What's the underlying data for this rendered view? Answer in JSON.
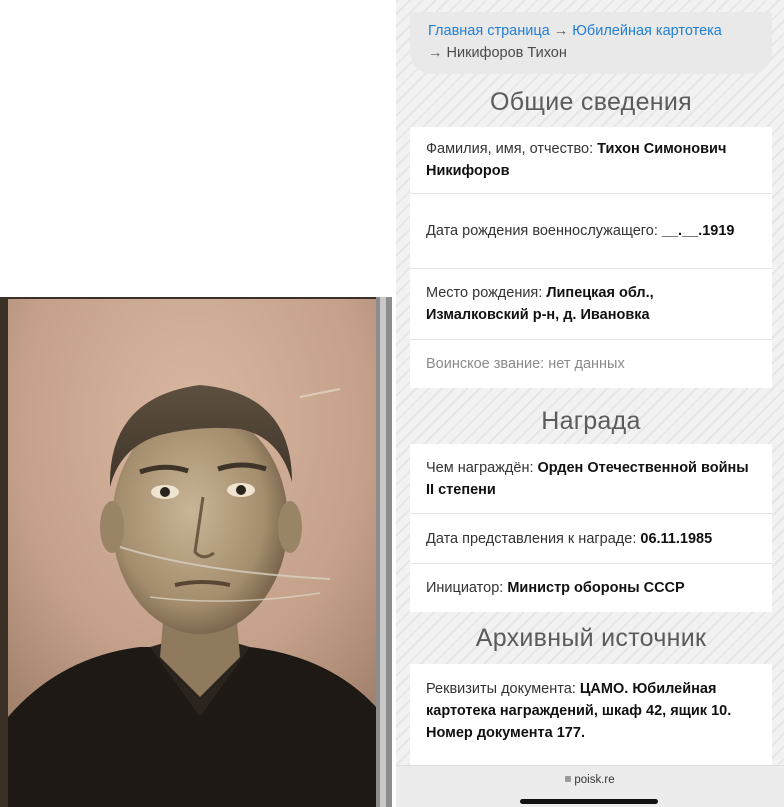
{
  "breadcrumb": {
    "home": "Главная страница",
    "arrow": "→",
    "catalog": "Юбилейная картотека",
    "current": "Никифоров Тихон"
  },
  "sections": {
    "general": {
      "title": "Общие сведения",
      "fio_label": "Фамилия, имя, отчество: ",
      "fio_value": "Тихон Симонович Никифоров",
      "birth_label": "Дата рождения военнослужащего: ",
      "birth_value": "__.__.1919",
      "place_label": "Место рождения: ",
      "place_value": "Липецкая обл., Измалковский р-н, д. Ивановка",
      "rank_text": "Воинское звание: нет данных"
    },
    "award": {
      "title": "Награда",
      "award_label": "Чем награждён: ",
      "award_value": "Орден Отечественной войны II степени",
      "date_label": "Дата представления к награде: ",
      "date_value": "06.11.1985",
      "initiator_label": "Инициатор: ",
      "initiator_value": "Министр обороны СССР"
    },
    "archive": {
      "title": "Архивный источник",
      "doc_label": "Реквизиты документа: ",
      "doc_value": "ЦАМО. Юбилейная картотека награждений, шкаф 42, ящик 10. Номер документа 177."
    }
  },
  "browser": {
    "url": "poisk.re",
    "lock_icon": "lock-icon"
  },
  "colors": {
    "link": "#1f7fd6",
    "title": "#5b5b5b",
    "card": "#ffffff"
  }
}
